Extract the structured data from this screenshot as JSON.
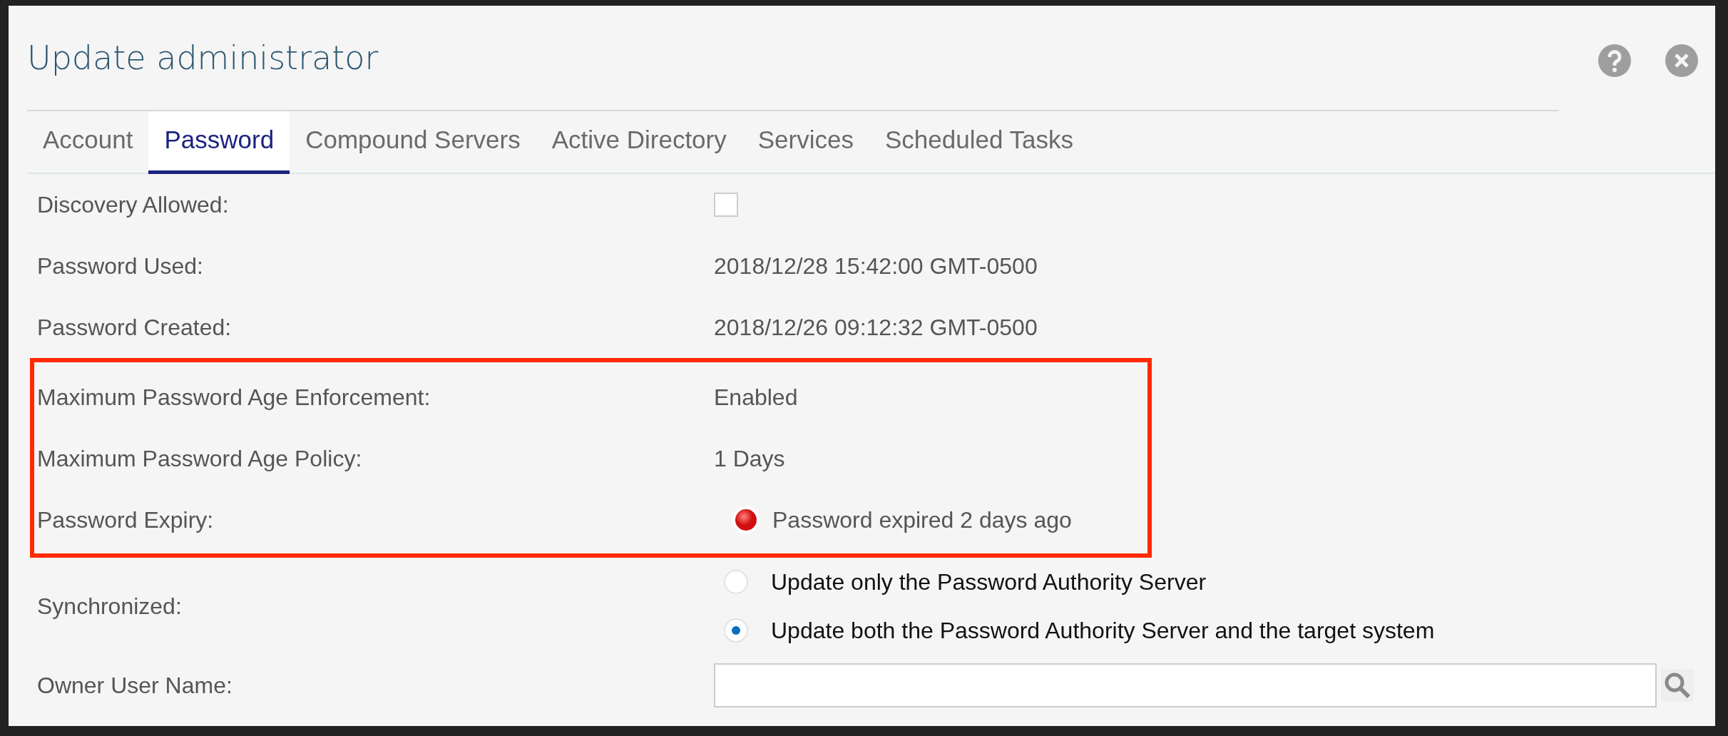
{
  "window": {
    "title": "Update administrator"
  },
  "header_icons": [
    {
      "kind": "help"
    },
    {
      "kind": "close"
    }
  ],
  "tabs": [
    {
      "label": "Account",
      "selected": false
    },
    {
      "label": "Password",
      "selected": true
    },
    {
      "label": "Compound Servers",
      "selected": false
    },
    {
      "label": "Active Directory",
      "selected": false
    },
    {
      "label": "Services",
      "selected": false
    },
    {
      "label": "Scheduled Tasks",
      "selected": false
    }
  ],
  "highlight": {
    "color": "#ff2a00"
  },
  "fields": [
    {
      "kind": "checkbox",
      "label": "Discovery Allowed:",
      "checked": false,
      "highlighted": false
    },
    {
      "kind": "text",
      "label": "Password Used:",
      "value": "2018/12/28 15:42:00 GMT-0500",
      "highlighted": false
    },
    {
      "kind": "text",
      "label": "Password Created:",
      "value": "2018/12/26 09:12:32 GMT-0500",
      "highlighted": false
    },
    {
      "kind": "text",
      "label": "Maximum Password Age Enforcement:",
      "value": "Enabled",
      "highlighted": true
    },
    {
      "kind": "text",
      "label": "Maximum Password Age Policy:",
      "value": "1 Days",
      "highlighted": true
    },
    {
      "kind": "status",
      "label": "Password Expiry:",
      "value": "Password expired 2 days ago",
      "color": "#d01010",
      "highlighted": true
    },
    {
      "kind": "radio",
      "label": "Synchronized:",
      "options": [
        {
          "label": "Update only the Password Authority Server",
          "selected": false
        },
        {
          "label": "Update both the Password Authority Server and the target system",
          "selected": true
        }
      ],
      "highlighted": false
    },
    {
      "kind": "search",
      "label": "Owner User Name:",
      "highlighted": false
    }
  ]
}
